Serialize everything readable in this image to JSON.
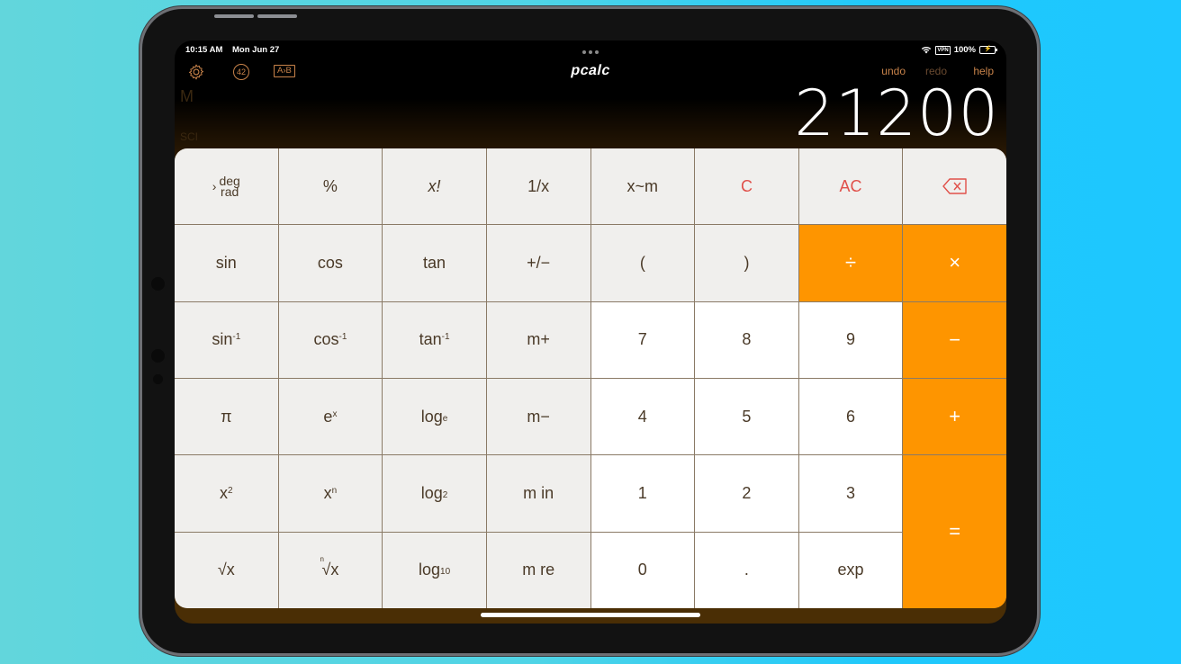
{
  "status_bar": {
    "time": "10:15 AM",
    "date": "Mon Jun 27",
    "vpn": "VPN",
    "battery": "100%",
    "multitask_dots": "•••"
  },
  "toolbar": {
    "settings_icon": "gear-icon",
    "tape_count": "42",
    "conversion_label": "A›B",
    "app_title": "pcalc",
    "undo_label": "undo",
    "redo_label": "redo",
    "help_label": "help"
  },
  "indicators": {
    "memory": "M",
    "mode": "SCI"
  },
  "display": {
    "value": "21200"
  },
  "keys": {
    "deg": "deg",
    "rad": "rad",
    "chevron": "›",
    "percent": "%",
    "factorial": "x!",
    "reciprocal": "1/x",
    "swap_memory": "x~m",
    "clear": "C",
    "all_clear": "AC",
    "sin": "sin",
    "cos": "cos",
    "tan": "tan",
    "plus_minus": "+/−",
    "open_paren": "(",
    "close_paren": ")",
    "divide": "÷",
    "multiply": "×",
    "asin": "sin",
    "acos": "cos",
    "atan": "tan",
    "inverse_sup": "-1",
    "m_plus": "m+",
    "seven": "7",
    "eight": "8",
    "nine": "9",
    "minus": "−",
    "pi": "π",
    "exp_base": "e",
    "exp_sup": "x",
    "log": "log",
    "log_e_sub": "e",
    "m_minus": "m−",
    "four": "4",
    "five": "5",
    "six": "6",
    "plus": "+",
    "square_base": "x",
    "square_sup": "2",
    "power_base": "x",
    "power_sup": "n",
    "log_2_sub": "2",
    "m_in": "m in",
    "one": "1",
    "two": "2",
    "three": "3",
    "equals": "=",
    "sqrt": "√x",
    "nroot_sup": "n",
    "nroot": "√x",
    "log_10_sub": "10",
    "m_recall": "m re",
    "zero": "0",
    "decimal": ".",
    "exp": "exp"
  },
  "colors": {
    "accent_orange": "#fe9500",
    "toolbar_brown": "#c8834a",
    "clear_red": "#e0504a",
    "function_key_bg": "#f0efed",
    "number_key_bg": "#ffffff"
  }
}
